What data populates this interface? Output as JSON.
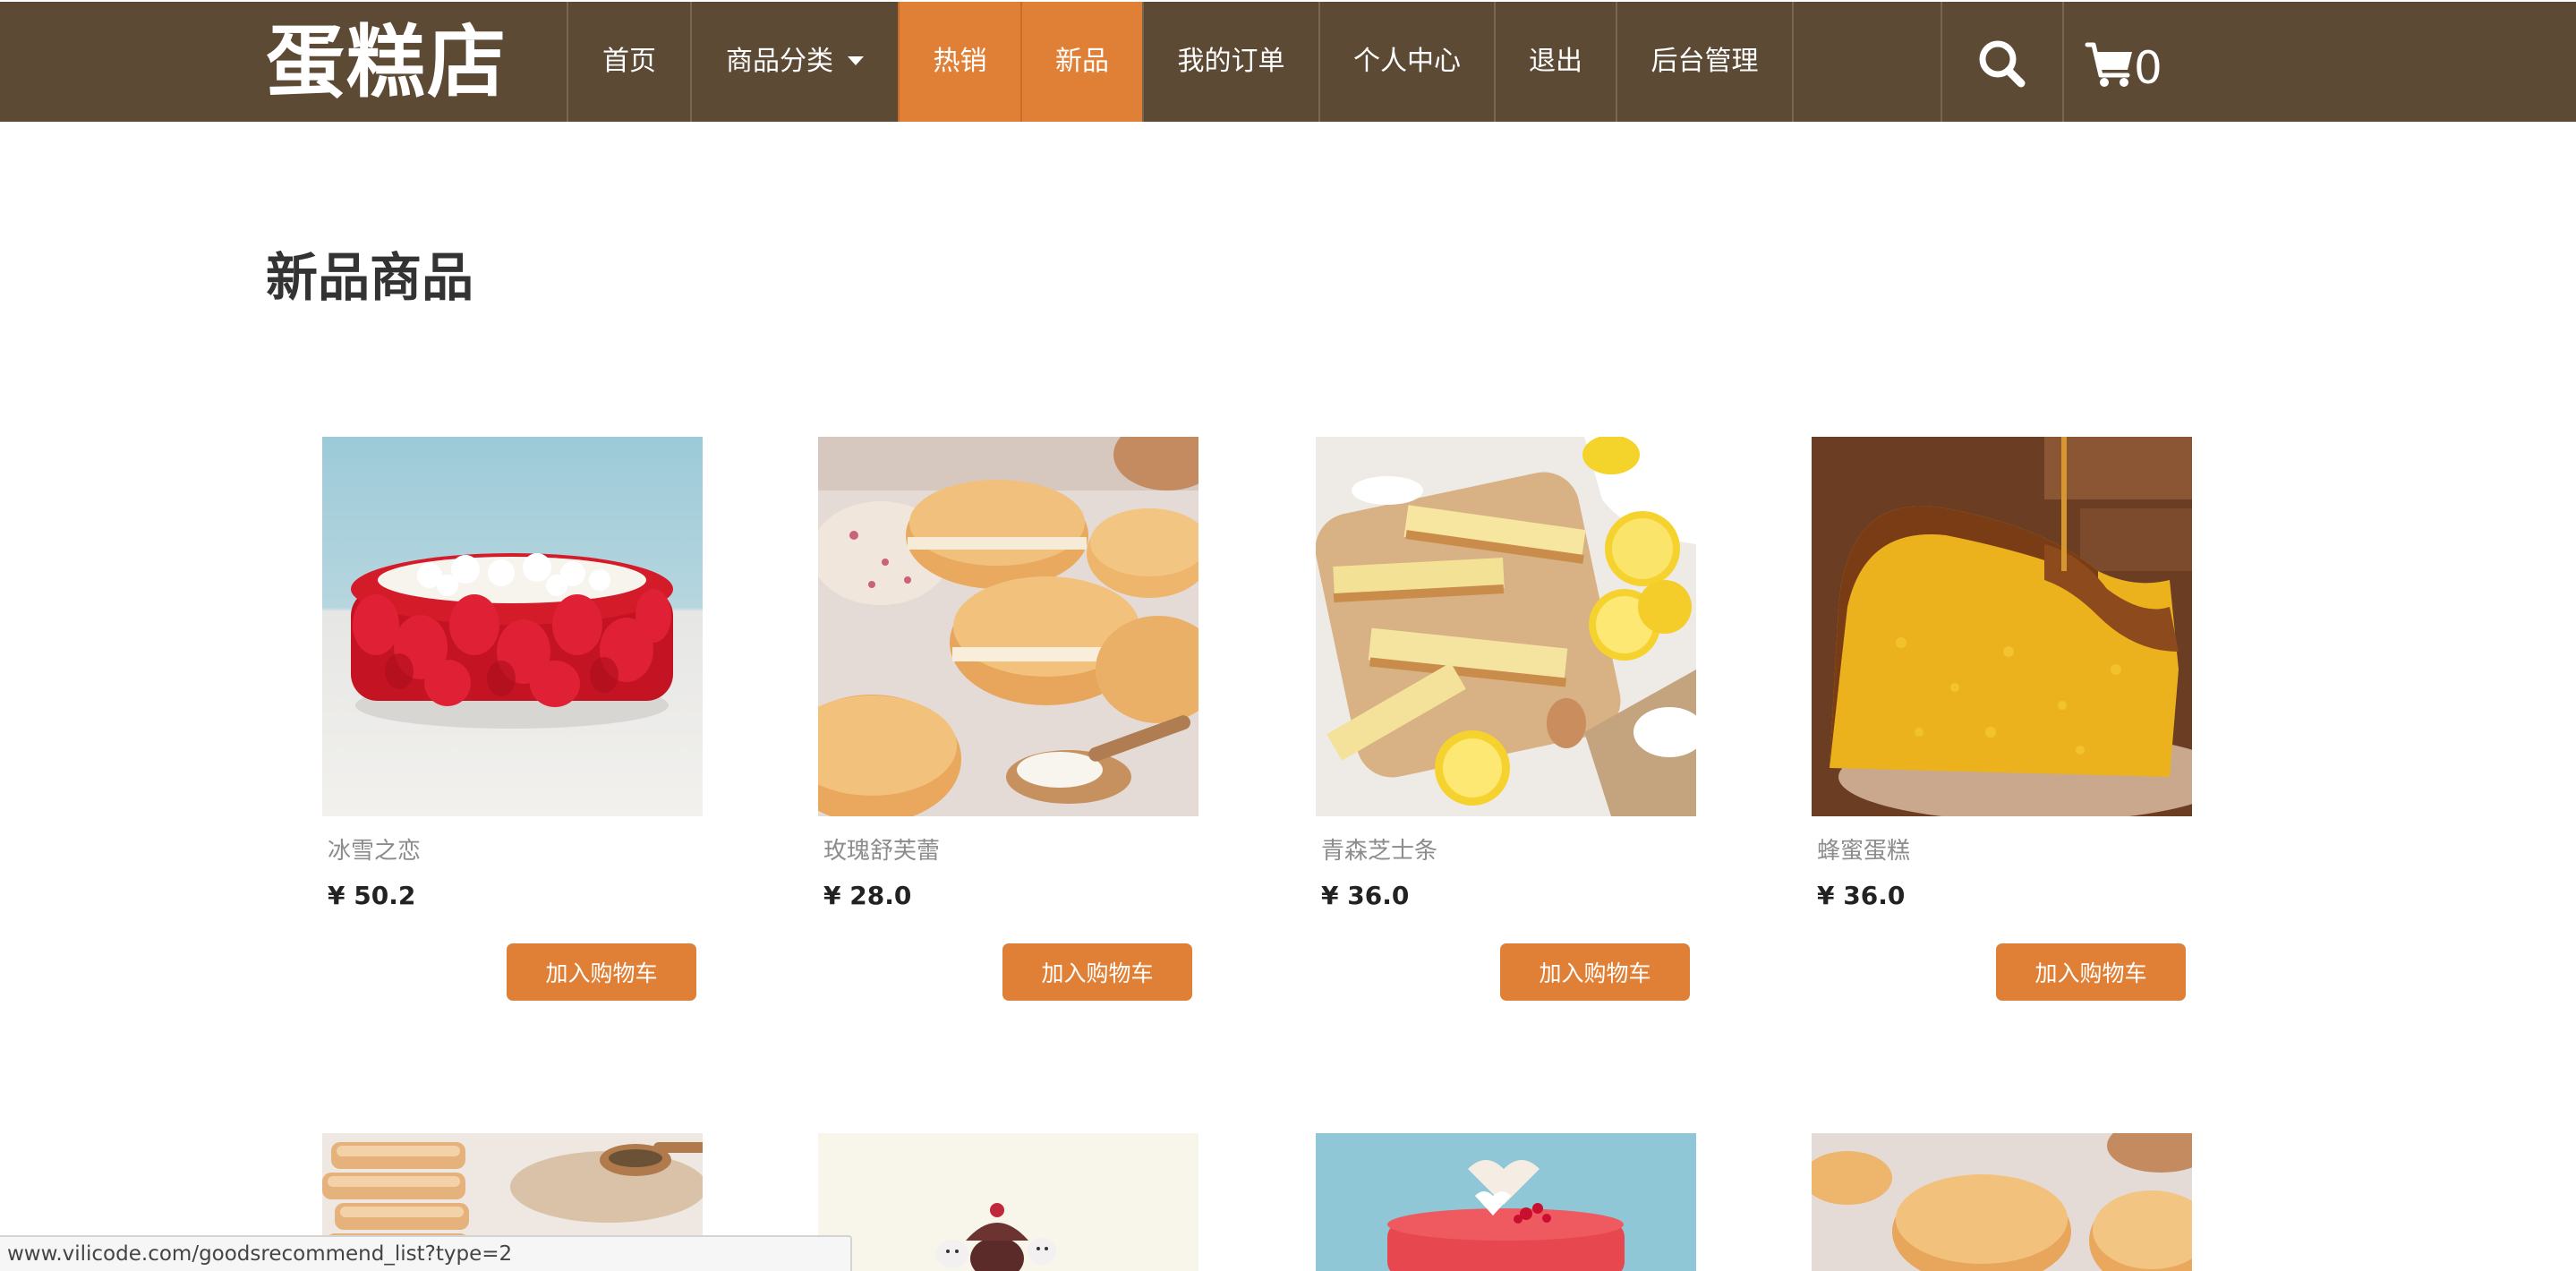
{
  "header": {
    "brand": "蛋糕店",
    "nav": [
      {
        "label": "首页"
      },
      {
        "label": "商品分类"
      },
      {
        "label": "热销"
      },
      {
        "label": "新品"
      },
      {
        "label": "我的订单"
      },
      {
        "label": "个人中心"
      },
      {
        "label": "退出"
      },
      {
        "label": "后台管理"
      }
    ],
    "active_tabs": [
      "热销",
      "新品"
    ],
    "search_icon": "search-icon",
    "cart_icon": "cart-icon",
    "cart_count": "0"
  },
  "main": {
    "title": "新品商品",
    "products": [
      {
        "name": "冰雪之恋",
        "price": "¥ 50.2",
        "button": "加入购物车"
      },
      {
        "name": "玫瑰舒芙蕾",
        "price": "¥ 28.0",
        "button": "加入购物车"
      },
      {
        "name": "青森芝士条",
        "price": "¥ 36.0",
        "button": "加入购物车"
      },
      {
        "name": "蜂蜜蛋糕",
        "price": "¥ 36.0",
        "button": "加入购物车"
      }
    ]
  },
  "status_bar": {
    "url": "www.vilicode.com/goodsrecommend_list?type=2"
  },
  "colors": {
    "nav_bg": "#5d4a35",
    "accent": "#e08036"
  }
}
